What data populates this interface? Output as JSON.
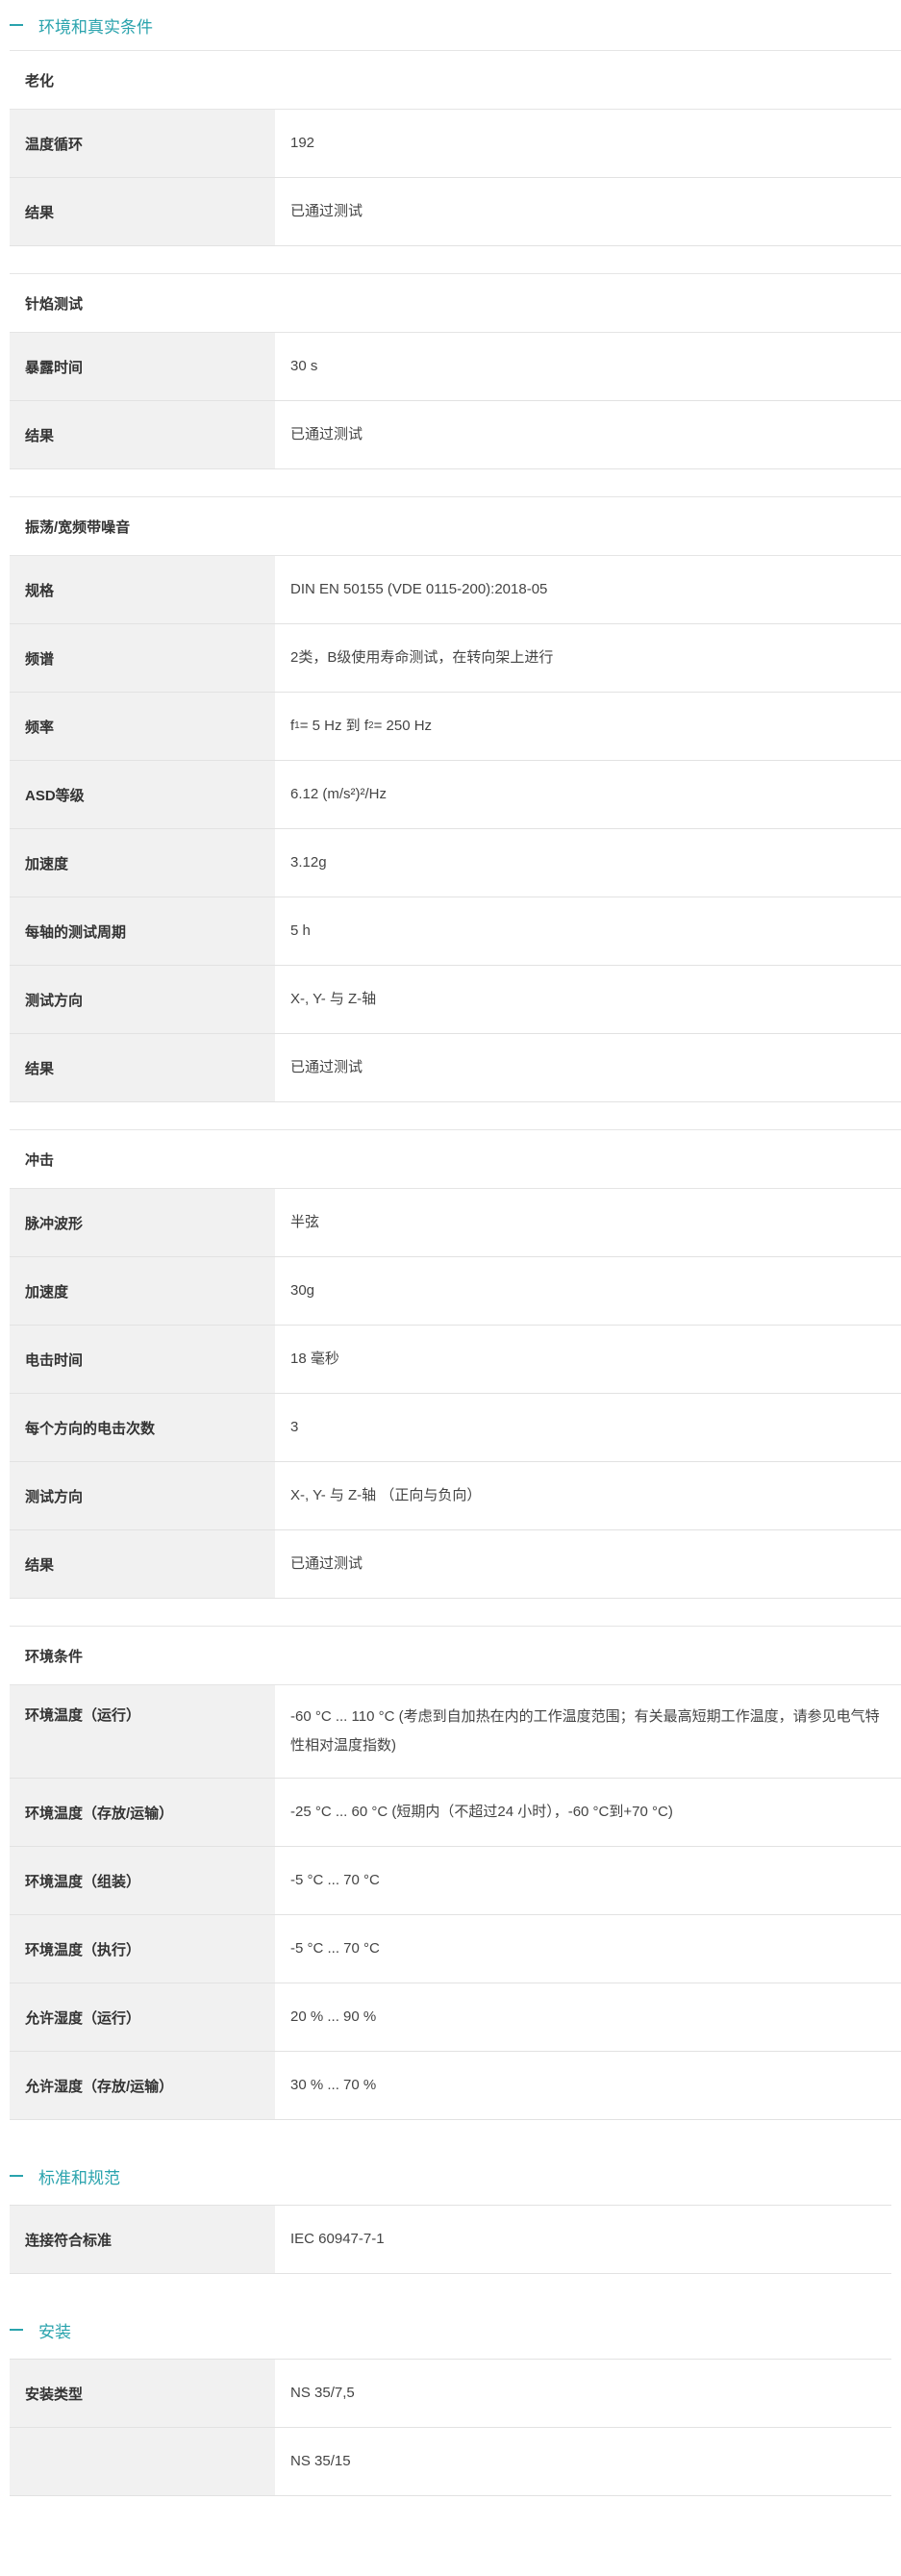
{
  "sections": {
    "env": {
      "title": "环境和真实条件"
    },
    "std": {
      "title": "标准和规范"
    },
    "mount": {
      "title": "安装"
    }
  },
  "aging": {
    "title": "老化",
    "rows": [
      {
        "k": "温度循环",
        "v": "192"
      },
      {
        "k": "结果",
        "v": "已通过测试"
      }
    ]
  },
  "needle": {
    "title": "针焰测试",
    "rows": [
      {
        "k": "暴露时间",
        "v": "30 s"
      },
      {
        "k": "结果",
        "v": "已通过测试"
      }
    ]
  },
  "vibration": {
    "title": "振荡/宽频带噪音",
    "rows": [
      {
        "k": "规格",
        "v": "DIN EN 50155 (VDE 0115-200):2018-05"
      },
      {
        "k": "频谱",
        "v": "2类，B级使用寿命测试，在转向架上进行"
      },
      {
        "k": "频率",
        "f_prefix": "f",
        "f1_sub": "1",
        "f_mid": " = 5 Hz 到 f",
        "f2_sub": "2",
        "f_suffix": " = 250 Hz"
      },
      {
        "k": "ASD等级",
        "v": "6.12 (m/s²)²/Hz"
      },
      {
        "k": "加速度",
        "v": "3.12g"
      },
      {
        "k": "每轴的测试周期",
        "v": "5 h"
      },
      {
        "k": "测试方向",
        "v": "X-, Y- 与 Z-轴"
      },
      {
        "k": "结果",
        "v": "已通过测试"
      }
    ]
  },
  "shock": {
    "title": "冲击",
    "rows": [
      {
        "k": "脉冲波形",
        "v": "半弦"
      },
      {
        "k": "加速度",
        "v": "30g"
      },
      {
        "k": "电击时间",
        "v": "18 毫秒"
      },
      {
        "k": "每个方向的电击次数",
        "v": "3"
      },
      {
        "k": "测试方向",
        "v": "X-, Y- 与 Z-轴 （正向与负向）"
      },
      {
        "k": "结果",
        "v": "已通过测试"
      }
    ]
  },
  "ambient": {
    "title": "环境条件",
    "rows": [
      {
        "k": "环境温度（运行）",
        "v": "-60 °C ... 110 °C (考虑到自加热在内的工作温度范围；有关最高短期工作温度，请参见电气特性相对温度指数)"
      },
      {
        "k": "环境温度（存放/运输）",
        "v": "-25 °C ... 60 °C (短期内（不超过24 小时），-60 °C到+70 °C)"
      },
      {
        "k": "环境温度（组装）",
        "v": "-5 °C ... 70 °C"
      },
      {
        "k": "环境温度（执行）",
        "v": "-5 °C ... 70 °C"
      },
      {
        "k": "允许湿度（运行）",
        "v": "20 % ... 90 %"
      },
      {
        "k": "允许湿度（存放/运输）",
        "v": "30 % ... 70 %"
      }
    ]
  },
  "standards": {
    "rows": [
      {
        "k": "连接符合标准",
        "v": "IEC 60947-7-1"
      }
    ]
  },
  "mounting": {
    "rows": [
      {
        "k": "安装类型",
        "v1": "NS 35/7,5",
        "v2": "NS 35/15"
      }
    ]
  }
}
